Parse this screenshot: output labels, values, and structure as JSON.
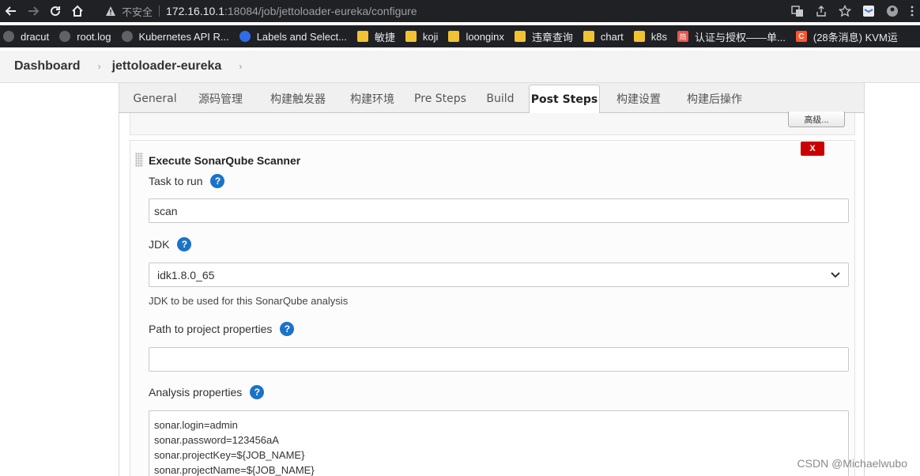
{
  "browser": {
    "insecure_label": "不安全",
    "url_host": "172.16.10.1",
    "url_rest": ":18084/job/jettoloader-eureka/configure"
  },
  "bookmarks": [
    {
      "label": "dracut",
      "icon": "globe-icon"
    },
    {
      "label": "root.log",
      "icon": "globe-icon"
    },
    {
      "label": "Kubernetes API R...",
      "icon": "globe-icon"
    },
    {
      "label": "Labels and Select...",
      "icon": "kubernetes-icon"
    },
    {
      "label": "敏捷",
      "icon": "folder-icon"
    },
    {
      "label": "koji",
      "icon": "folder-icon"
    },
    {
      "label": "loonginx",
      "icon": "folder-icon"
    },
    {
      "label": "违章查询",
      "icon": "folder-icon"
    },
    {
      "label": "chart",
      "icon": "folder-icon"
    },
    {
      "label": "k8s",
      "icon": "folder-icon"
    },
    {
      "label": "认证与授权——单...",
      "icon": "jian-icon",
      "glyph": "简"
    },
    {
      "label": "(28条消息) KVM运",
      "icon": "csdn-icon",
      "glyph": "C"
    }
  ],
  "breadcrumb": {
    "dashboard": "Dashboard",
    "job": "jettoloader-eureka"
  },
  "tabs": [
    {
      "label": "General"
    },
    {
      "label": "源码管理"
    },
    {
      "label": "构建触发器"
    },
    {
      "label": "构建环境"
    },
    {
      "label": "Pre Steps"
    },
    {
      "label": "Build"
    },
    {
      "label": "Post Steps"
    },
    {
      "label": "构建设置"
    },
    {
      "label": "构建后操作"
    }
  ],
  "prev_section": {
    "advanced_button": "高级..."
  },
  "step": {
    "delete_label": "X",
    "title": "Execute SonarQube Scanner",
    "task_label": "Task to run",
    "task_value": "scan",
    "jdk_label": "JDK",
    "jdk_selected": "idk1.8.0_65",
    "jdk_hint": "JDK to be used for this SonarQube analysis",
    "path_label": "Path to project properties",
    "path_value": "",
    "analysis_label": "Analysis properties",
    "analysis_lines": [
      "sonar.login=admin",
      "sonar.password=123456aA",
      "sonar.projectKey=${JOB_NAME}",
      "sonar.projectName=${JOB_NAME}"
    ],
    "help_glyph": "?"
  },
  "watermark": "CSDN @Michaelwubo"
}
